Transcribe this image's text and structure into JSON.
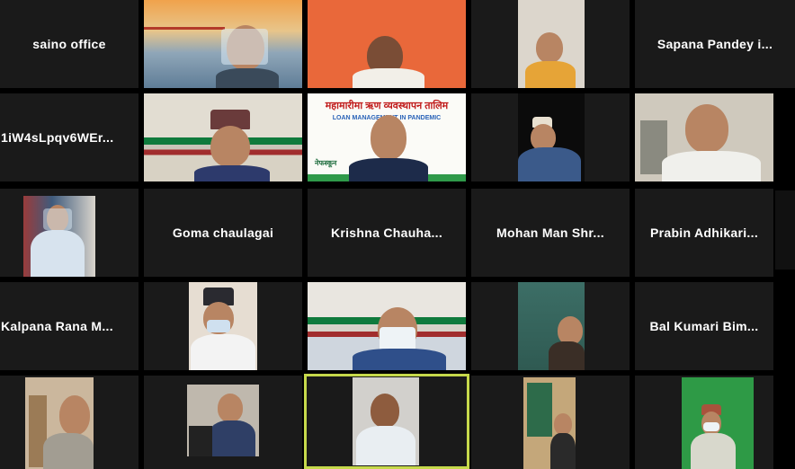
{
  "participants": {
    "saino_office": "saino office",
    "sapana": "Sapana  Pandey  i...",
    "iw4s": "1iW4sLpqv6WEr...",
    "goma": "Goma chaulagai",
    "krishna": "Krishna  Chauha...",
    "mohan": "Mohan  Man  Shr...",
    "prabin": "Prabin  Adhikari...",
    "kalpana": "Kalpana  Rana  M...",
    "bal_kumari": "Bal Kumari Bim..."
  },
  "banner": {
    "title": "महामारीमा ऋण व्यवस्थापन तालिम",
    "subtitle": "LOAN MANAGEMENT IN PANDEMIC",
    "logo_text": "नेफस्कून"
  },
  "colors": {
    "tile_bg": "#1a1a1a",
    "active_border": "#c6d94b",
    "name_text": "#ffffff"
  }
}
